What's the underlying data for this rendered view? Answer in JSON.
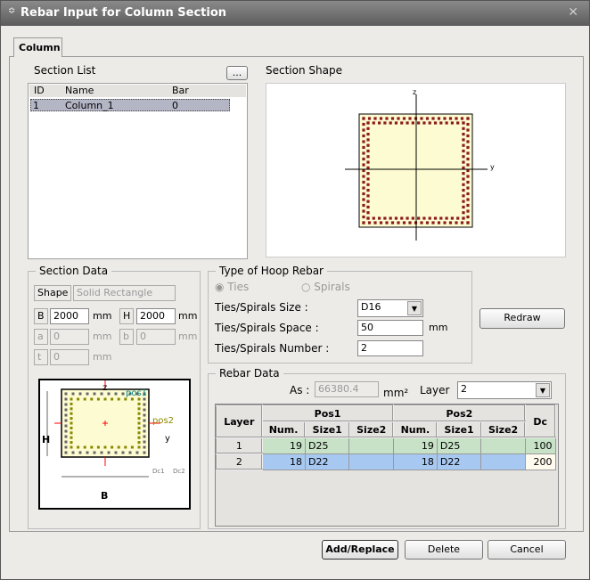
{
  "window": {
    "title": "Rebar Input for Column Section",
    "close": "✕"
  },
  "tab": "Column",
  "section_list": {
    "label": "Section List",
    "more_button": "...",
    "columns": [
      "ID",
      "Name",
      "Bar"
    ],
    "rows": [
      {
        "id": "1",
        "name": "Column_1",
        "bar": "0"
      }
    ]
  },
  "section_shape": {
    "label": "Section Shape",
    "axis_z": "z",
    "axis_y": "y"
  },
  "section_data": {
    "label": "Section Data",
    "shape_label": "Shape",
    "shape_value": "Solid Rectangle",
    "b_label": "B",
    "b_value": "2000",
    "h_label": "H",
    "h_value": "2000",
    "a_label": "a",
    "a_value": "0",
    "b2_label": "b",
    "b2_value": "0",
    "t_label": "t",
    "t_value": "0",
    "unit": "mm",
    "diagram": {
      "z": "z",
      "y": "y",
      "pos1": "pos1",
      "pos2": "pos2",
      "H": "H",
      "B": "B",
      "dc": "Dc1",
      "dc2": "Dc2"
    }
  },
  "hoop": {
    "label": "Type of Hoop Rebar",
    "ties": "Ties",
    "spirals": "Spirals",
    "size_label": "Ties/Spirals Size :",
    "size_value": "D16",
    "space_label": "Ties/Spirals Space :",
    "space_value": "50",
    "space_unit": "mm",
    "number_label": "Ties/Spirals Number :",
    "number_value": "2"
  },
  "redraw": "Redraw",
  "rebar": {
    "label": "Rebar Data",
    "as_label": "As :",
    "as_value": "66380.4",
    "as_unit": "mm²",
    "layer_label": "Layer",
    "layer_value": "2",
    "headers": {
      "layer": "Layer",
      "pos1": "Pos1",
      "pos2": "Pos2",
      "dc": "Dc",
      "num": "Num.",
      "size1": "Size1",
      "size2": "Size2"
    },
    "rows": [
      {
        "layer": "1",
        "n1": "19",
        "s11": "D25",
        "s12": "",
        "n2": "19",
        "s21": "D25",
        "s22": "",
        "dc": "100"
      },
      {
        "layer": "2",
        "n1": "18",
        "s11": "D22",
        "s12": "",
        "n2": "18",
        "s21": "D22",
        "s22": "",
        "dc": "200"
      }
    ]
  },
  "buttons": {
    "add": "Add/Replace",
    "delete": "Delete",
    "cancel": "Cancel"
  }
}
